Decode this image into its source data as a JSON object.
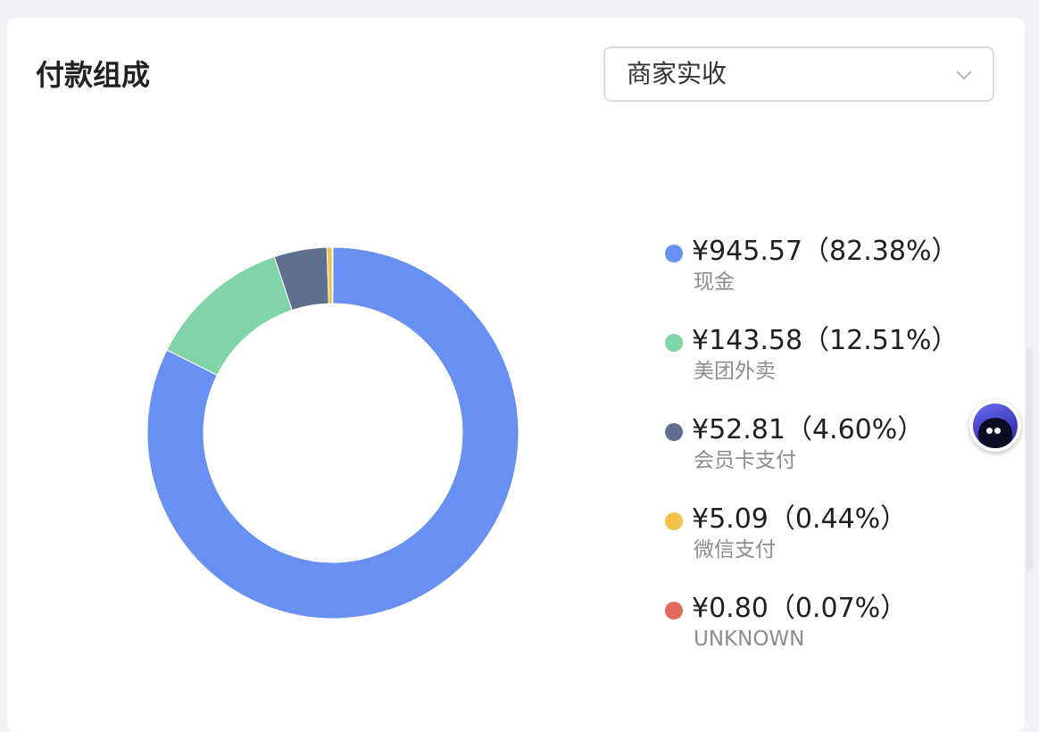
{
  "header": {
    "title": "付款组成"
  },
  "filter": {
    "selected": "商家实收"
  },
  "chart_data": {
    "type": "pie",
    "donut": true,
    "categories": [
      "现金",
      "美团外卖",
      "会员卡支付",
      "微信支付",
      "UNKNOWN"
    ],
    "values": [
      945.57,
      143.58,
      52.81,
      5.09,
      0.8
    ],
    "percentages": [
      82.38,
      12.51,
      4.6,
      0.44,
      0.07
    ],
    "colors": [
      "#6890f2",
      "#7fd5a8",
      "#5f6f8e",
      "#f2c14a",
      "#e06b5c"
    ],
    "legend_position": "right"
  },
  "legend": [
    {
      "value_text": "¥945.57（82.38%）",
      "name": "现金",
      "color": "#6890f2"
    },
    {
      "value_text": "¥143.58（12.51%）",
      "name": "美团外卖",
      "color": "#7fd5a8"
    },
    {
      "value_text": "¥52.81（4.60%）",
      "name": "会员卡支付",
      "color": "#5f6f8e"
    },
    {
      "value_text": "¥5.09（0.44%）",
      "name": "微信支付",
      "color": "#f2c14a"
    },
    {
      "value_text": "¥0.80（0.07%）",
      "name": "UNKNOWN",
      "color": "#e06b5c"
    }
  ],
  "assistant": {
    "icon": "assistant-avatar-icon"
  }
}
